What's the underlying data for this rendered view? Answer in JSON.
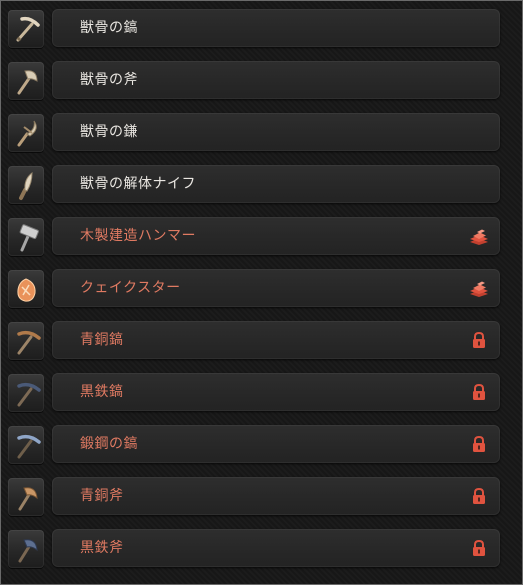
{
  "colors": {
    "available_text": "#e9e6e1",
    "locked_text": "#e07a62",
    "status_icon": "#e0533f"
  },
  "items": [
    {
      "label": "獣骨の鎬",
      "state": "available",
      "icon": "bone-pickaxe-icon",
      "status_icon": null
    },
    {
      "label": "獣骨の斧",
      "state": "available",
      "icon": "bone-axe-icon",
      "status_icon": null
    },
    {
      "label": "獣骨の鎌",
      "state": "available",
      "icon": "bone-sickle-icon",
      "status_icon": null
    },
    {
      "label": "獣骨の解体ナイフ",
      "state": "available",
      "icon": "bone-knife-icon",
      "status_icon": null
    },
    {
      "label": "木製建造ハンマー",
      "state": "locked",
      "icon": "wooden-hammer-icon",
      "status_icon": "materials-icon"
    },
    {
      "label": "クェイクスター",
      "state": "locked",
      "icon": "quakestar-icon",
      "status_icon": "materials-icon"
    },
    {
      "label": "青銅鎬",
      "state": "locked",
      "icon": "bronze-pickaxe-icon",
      "status_icon": "lock-icon"
    },
    {
      "label": "黒鉄鎬",
      "state": "locked",
      "icon": "black-iron-pickaxe-icon",
      "status_icon": "lock-icon"
    },
    {
      "label": "鍛鋼の鎬",
      "state": "locked",
      "icon": "steel-pickaxe-icon",
      "status_icon": "lock-icon"
    },
    {
      "label": "青銅斧",
      "state": "locked",
      "icon": "bronze-axe-icon",
      "status_icon": "lock-icon"
    },
    {
      "label": "黒鉄斧",
      "state": "locked",
      "icon": "black-iron-axe-icon",
      "status_icon": "lock-icon"
    }
  ]
}
